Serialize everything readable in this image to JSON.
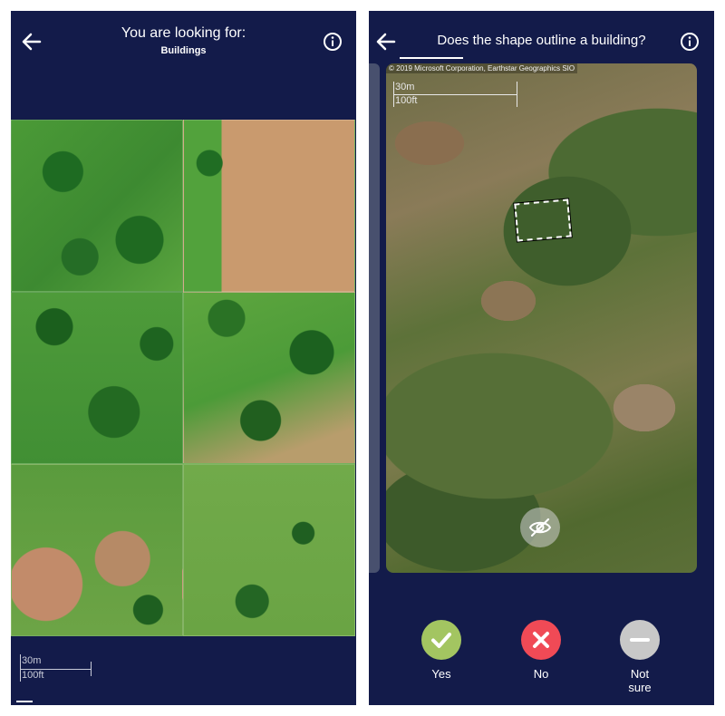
{
  "left": {
    "title": "You are looking for:",
    "subtitle": "Buildings",
    "back_icon": "arrow-left-icon",
    "info_icon": "info-icon",
    "scale": {
      "metric": "30m",
      "imperial": "100ft"
    }
  },
  "right": {
    "question": "Does the shape outline a building?",
    "back_icon": "arrow-left-icon",
    "info_icon": "info-icon",
    "attribution": "© 2019 Microsoft Corporation, Earthstar Geographics SIO",
    "scale": {
      "metric": "30m",
      "imperial": "100ft"
    },
    "hide_outline_icon": "eye-slash-icon",
    "answers": [
      {
        "label": "Yes",
        "color": "#a3c561",
        "icon": "check-icon"
      },
      {
        "label": "No",
        "color": "#f04a56",
        "icon": "x-icon"
      },
      {
        "label": "Not\nsure",
        "color": "#c8c8c8",
        "icon": "minus-icon"
      }
    ]
  },
  "colors": {
    "panel_bg": "#131b4a",
    "text": "#ffffff"
  }
}
